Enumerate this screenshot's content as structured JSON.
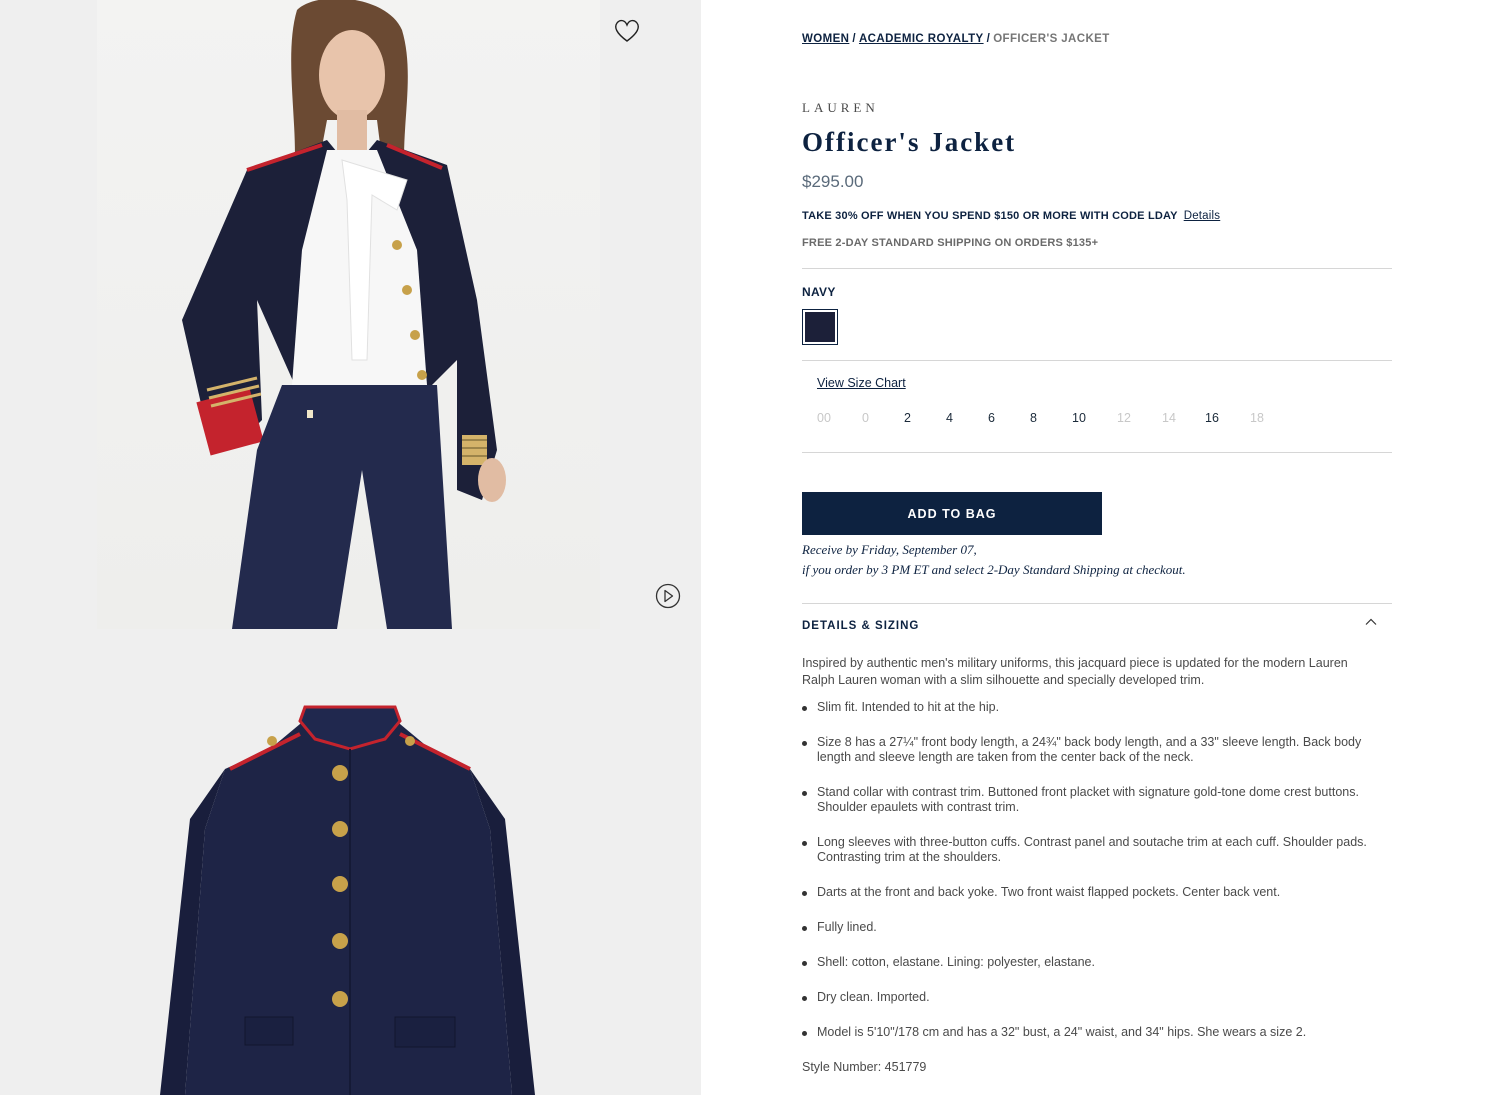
{
  "breadcrumb": {
    "items": [
      "WOMEN",
      "ACADEMIC ROYALTY"
    ],
    "current": "OFFICER'S JACKET"
  },
  "product": {
    "brand": "LAUREN",
    "title": "Officer's Jacket",
    "price": "$295.00",
    "promo": "TAKE 30% OFF WHEN YOU SPEND $150 OR MORE WITH CODE LDAY",
    "promo_link": "Details",
    "shipping": "FREE 2-DAY STANDARD SHIPPING ON ORDERS $135+"
  },
  "color": {
    "selected": "NAVY",
    "swatch_hex": "#1c2039"
  },
  "sizes": {
    "chart_link": "View Size Chart",
    "options": [
      {
        "label": "00",
        "available": false
      },
      {
        "label": "0",
        "available": false
      },
      {
        "label": "2",
        "available": true
      },
      {
        "label": "4",
        "available": true
      },
      {
        "label": "6",
        "available": true
      },
      {
        "label": "8",
        "available": true
      },
      {
        "label": "10",
        "available": true
      },
      {
        "label": "12",
        "available": false
      },
      {
        "label": "14",
        "available": false
      },
      {
        "label": "16",
        "available": true
      },
      {
        "label": "18",
        "available": false
      }
    ]
  },
  "cart": {
    "add_label": "ADD TO BAG",
    "delivery_line1": "Receive by Friday, September 07,",
    "delivery_line2": "if you order by 3 PM ET and select 2-Day Standard Shipping at checkout."
  },
  "details": {
    "heading": "DETAILS & SIZING",
    "description": "Inspired by authentic men's military uniforms, this jacquard piece is updated for the modern Lauren Ralph Lauren woman with a slim silhouette and specially developed trim.",
    "bullets": [
      "Slim fit. Intended to hit at the hip.",
      "Size 8 has a 27¼\" front body length, a 24¾\" back body length, and a 33\" sleeve length. Back body length and sleeve length are taken from the center back of the neck.",
      "Stand collar with contrast trim. Buttoned front placket with signature gold-tone dome crest buttons. Shoulder epaulets with contrast trim.",
      "Long sleeves with three-button cuffs. Contrast panel and soutache trim at each cuff. Shoulder pads. Contrasting trim at the shoulders.",
      "Darts at the front and back yoke. Two front waist flapped pockets. Center back vent.",
      "Fully lined.",
      "Shell: cotton, elastane. Lining: polyester, elastane.",
      "Dry clean. Imported.",
      "Model is 5'10\"/178 cm and has a 32\" bust, a 24\" waist, and 34\" hips. She wears a size 2."
    ],
    "style_number": "Style Number: 451779"
  },
  "icons": {
    "wishlist": "heart-icon",
    "video": "play-icon",
    "accordion": "chevron-up-icon"
  }
}
